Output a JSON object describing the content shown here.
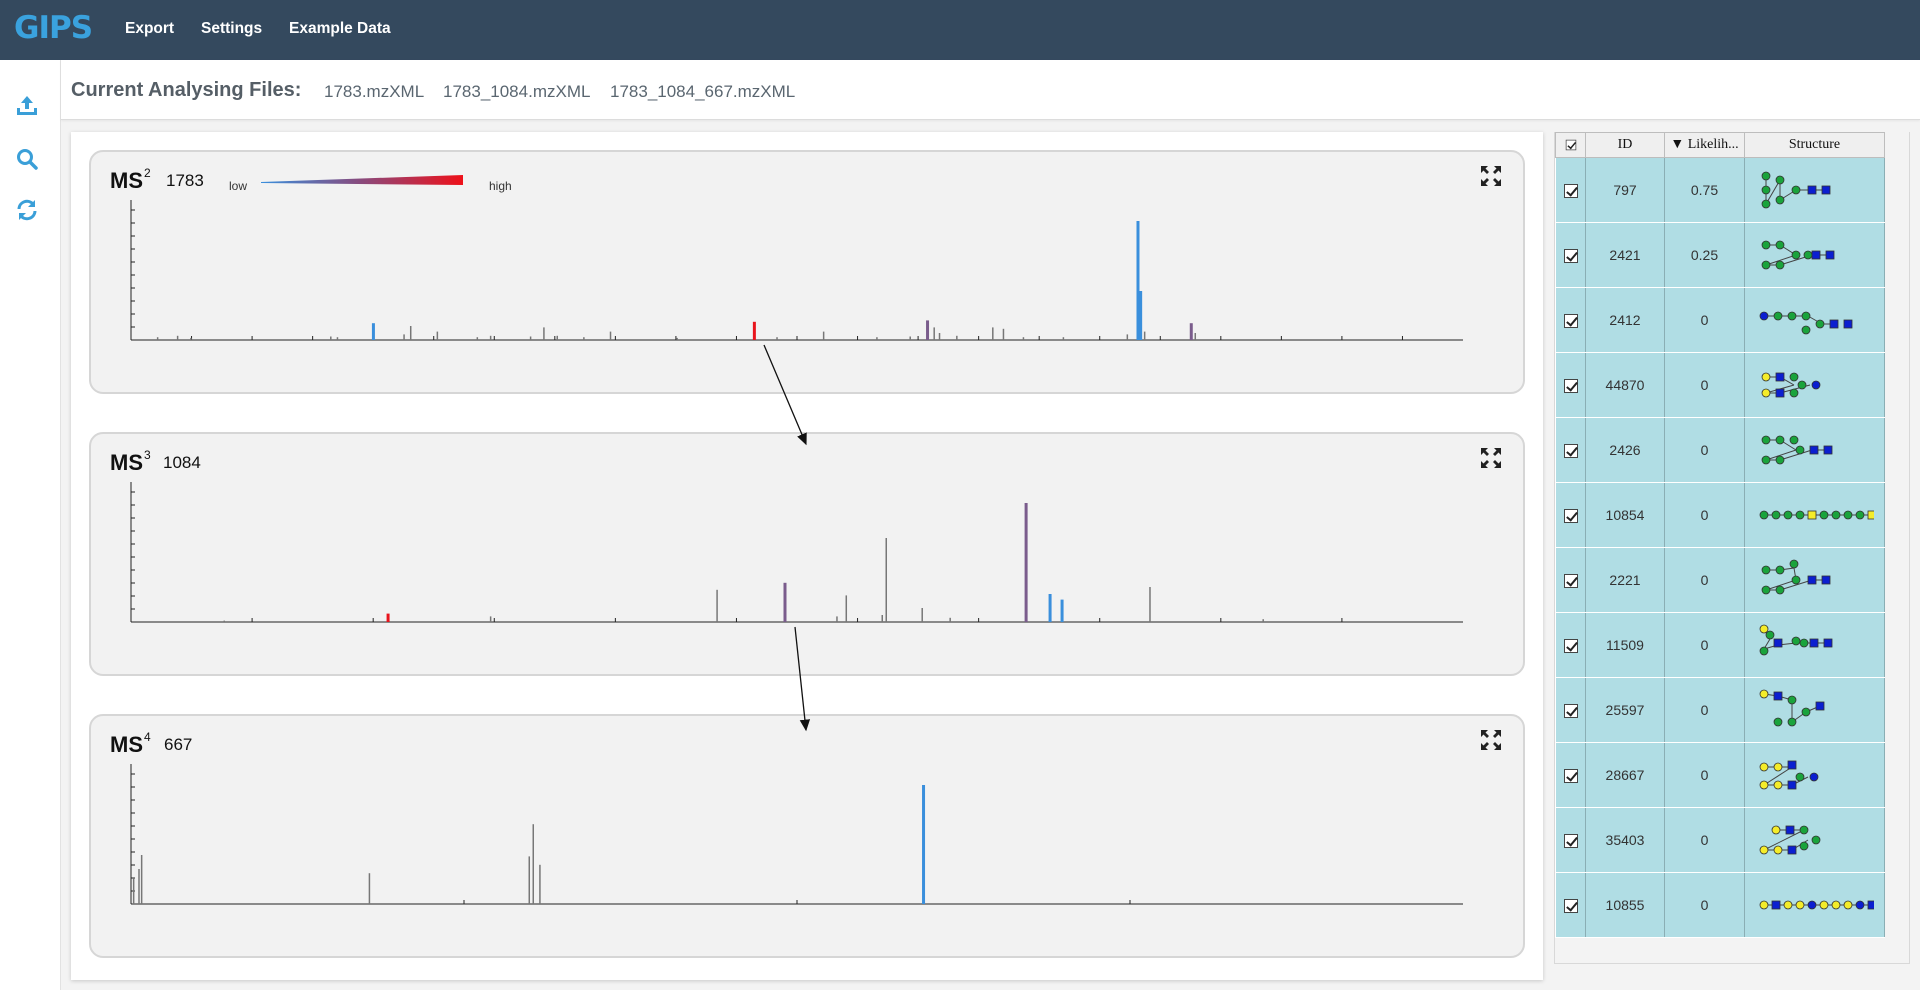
{
  "nav": {
    "brand": "GIPS",
    "links": [
      "Export",
      "Settings",
      "Example Data"
    ]
  },
  "sidebar": {
    "icons": [
      "upload-icon",
      "search-icon",
      "refresh-icon"
    ]
  },
  "files": {
    "title": "Current Analysing Files:",
    "items": [
      "1783.mzXML",
      "1783_1084.mzXML",
      "1783_1084_667.mzXML"
    ]
  },
  "colors": {
    "nav_bg": "#34495e",
    "brand": "#3aa2de",
    "peak_default": "#777777",
    "peak_blue": "#3a8fdc",
    "peak_red": "#e8141c",
    "peak_purple": "#7a5c8c",
    "table_row": "#b0dde4"
  },
  "spectra": [
    {
      "level": "MS",
      "order": "2",
      "precursor": "1783",
      "legend": {
        "low": "low",
        "high": "high"
      },
      "peaks": [
        {
          "x": 0.02,
          "h": 0.02,
          "c": "g"
        },
        {
          "x": 0.035,
          "h": 0.03,
          "c": "g"
        },
        {
          "x": 0.045,
          "h": 0.015,
          "c": "g"
        },
        {
          "x": 0.15,
          "h": 0.025,
          "c": "g"
        },
        {
          "x": 0.155,
          "h": 0.02,
          "c": "g"
        },
        {
          "x": 0.182,
          "h": 0.12,
          "c": "b"
        },
        {
          "x": 0.205,
          "h": 0.04,
          "c": "g"
        },
        {
          "x": 0.21,
          "h": 0.1,
          "c": "g"
        },
        {
          "x": 0.23,
          "h": 0.06,
          "c": "g"
        },
        {
          "x": 0.26,
          "h": 0.02,
          "c": "g"
        },
        {
          "x": 0.27,
          "h": 0.03,
          "c": "g"
        },
        {
          "x": 0.3,
          "h": 0.025,
          "c": "g"
        },
        {
          "x": 0.31,
          "h": 0.09,
          "c": "g"
        },
        {
          "x": 0.32,
          "h": 0.03,
          "c": "g"
        },
        {
          "x": 0.34,
          "h": 0.02,
          "c": "g"
        },
        {
          "x": 0.36,
          "h": 0.06,
          "c": "g"
        },
        {
          "x": 0.41,
          "h": 0.015,
          "c": "g"
        },
        {
          "x": 0.468,
          "h": 0.13,
          "c": "r"
        },
        {
          "x": 0.485,
          "h": 0.02,
          "c": "g"
        },
        {
          "x": 0.52,
          "h": 0.06,
          "c": "g"
        },
        {
          "x": 0.56,
          "h": 0.02,
          "c": "g"
        },
        {
          "x": 0.585,
          "h": 0.025,
          "c": "g"
        },
        {
          "x": 0.598,
          "h": 0.14,
          "c": "p"
        },
        {
          "x": 0.603,
          "h": 0.09,
          "c": "g"
        },
        {
          "x": 0.607,
          "h": 0.05,
          "c": "g"
        },
        {
          "x": 0.62,
          "h": 0.03,
          "c": "g"
        },
        {
          "x": 0.647,
          "h": 0.09,
          "c": "g"
        },
        {
          "x": 0.655,
          "h": 0.08,
          "c": "g"
        },
        {
          "x": 0.67,
          "h": 0.02,
          "c": "g"
        },
        {
          "x": 0.7,
          "h": 0.02,
          "c": "g"
        },
        {
          "x": 0.748,
          "h": 0.04,
          "c": "g"
        },
        {
          "x": 0.756,
          "h": 0.85,
          "c": "b"
        },
        {
          "x": 0.758,
          "h": 0.35,
          "c": "b"
        },
        {
          "x": 0.761,
          "h": 0.06,
          "c": "g"
        },
        {
          "x": 0.796,
          "h": 0.12,
          "c": "p"
        },
        {
          "x": 0.799,
          "h": 0.05,
          "c": "g"
        }
      ],
      "ticks": 21
    },
    {
      "level": "MS",
      "order": "3",
      "precursor": "1084",
      "peaks": [
        {
          "x": 0.07,
          "h": 0.01,
          "c": "g"
        },
        {
          "x": 0.193,
          "h": 0.06,
          "c": "r"
        },
        {
          "x": 0.27,
          "h": 0.04,
          "c": "g"
        },
        {
          "x": 0.44,
          "h": 0.23,
          "c": "g"
        },
        {
          "x": 0.491,
          "h": 0.28,
          "c": "p"
        },
        {
          "x": 0.53,
          "h": 0.04,
          "c": "g"
        },
        {
          "x": 0.537,
          "h": 0.19,
          "c": "g"
        },
        {
          "x": 0.564,
          "h": 0.05,
          "c": "g"
        },
        {
          "x": 0.567,
          "h": 0.6,
          "c": "g"
        },
        {
          "x": 0.594,
          "h": 0.1,
          "c": "g"
        },
        {
          "x": 0.615,
          "h": 0.03,
          "c": "g"
        },
        {
          "x": 0.672,
          "h": 0.85,
          "c": "p"
        },
        {
          "x": 0.69,
          "h": 0.2,
          "c": "b"
        },
        {
          "x": 0.699,
          "h": 0.16,
          "c": "b"
        },
        {
          "x": 0.765,
          "h": 0.25,
          "c": "g"
        },
        {
          "x": 0.85,
          "h": 0.02,
          "c": "g"
        }
      ],
      "ticks": 10
    },
    {
      "level": "MS",
      "order": "4",
      "precursor": "667",
      "peaks": [
        {
          "x": 0.002,
          "h": 0.18,
          "c": "g"
        },
        {
          "x": 0.006,
          "h": 0.25,
          "c": "g"
        },
        {
          "x": 0.008,
          "h": 0.35,
          "c": "g"
        },
        {
          "x": 0.179,
          "h": 0.22,
          "c": "g"
        },
        {
          "x": 0.299,
          "h": 0.34,
          "c": "g"
        },
        {
          "x": 0.302,
          "h": 0.57,
          "c": "g"
        },
        {
          "x": 0.307,
          "h": 0.28,
          "c": "g"
        },
        {
          "x": 0.595,
          "h": 0.85,
          "c": "b"
        }
      ],
      "ticks": 3
    }
  ],
  "table": {
    "headers": {
      "id": "ID",
      "likelihood": "▼ Likelih...",
      "structure": "Structure"
    },
    "rows": [
      {
        "id": "797",
        "likelihood": "0.75",
        "structure": "glycan-structure-1"
      },
      {
        "id": "2421",
        "likelihood": "0.25",
        "structure": "glycan-structure-2"
      },
      {
        "id": "2412",
        "likelihood": "0",
        "structure": "glycan-structure-3"
      },
      {
        "id": "44870",
        "likelihood": "0",
        "structure": "glycan-structure-4"
      },
      {
        "id": "2426",
        "likelihood": "0",
        "structure": "glycan-structure-5"
      },
      {
        "id": "10854",
        "likelihood": "0",
        "structure": "glycan-structure-6"
      },
      {
        "id": "2221",
        "likelihood": "0",
        "structure": "glycan-structure-7"
      },
      {
        "id": "11509",
        "likelihood": "0",
        "structure": "glycan-structure-8"
      },
      {
        "id": "25597",
        "likelihood": "0",
        "structure": "glycan-structure-9"
      },
      {
        "id": "28667",
        "likelihood": "0",
        "structure": "glycan-structure-10"
      },
      {
        "id": "35403",
        "likelihood": "0",
        "structure": "glycan-structure-11"
      },
      {
        "id": "10855",
        "likelihood": "0",
        "structure": "glycan-structure-12"
      }
    ]
  }
}
